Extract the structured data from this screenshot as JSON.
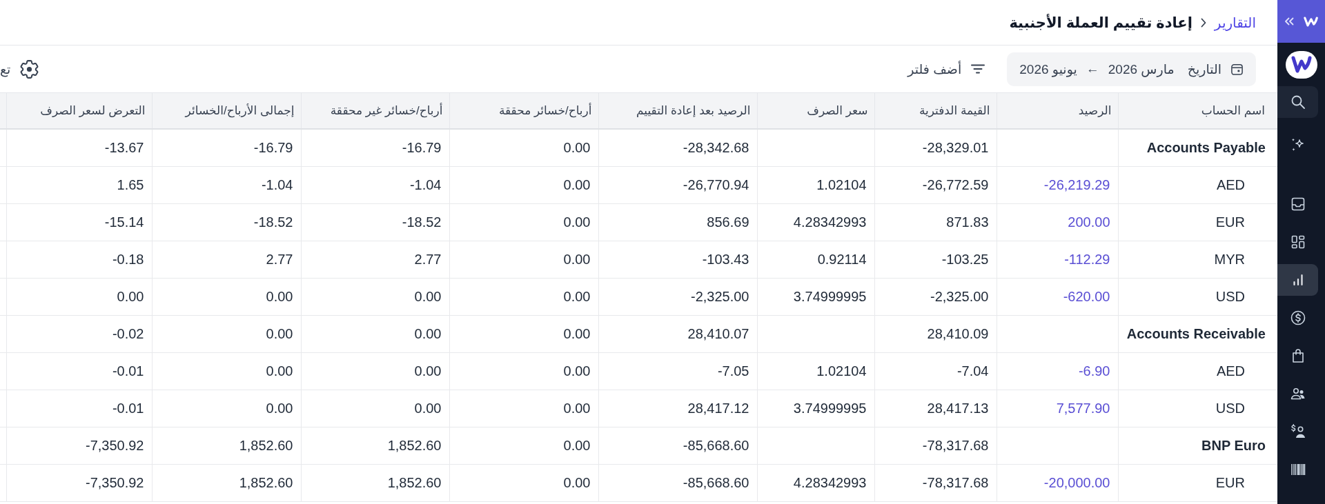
{
  "sidebar": {
    "items": [
      {
        "selected": false
      },
      {
        "selected": false
      },
      {
        "selected": false
      },
      {
        "selected": true
      },
      {
        "selected": false
      },
      {
        "selected": false
      },
      {
        "selected": false
      },
      {
        "selected": false
      },
      {
        "selected": false
      }
    ]
  },
  "header": {
    "breadcrumb": {
      "parent": "التقارير",
      "title": "إعادة تقييم العملة الأجنبية"
    }
  },
  "toolbar": {
    "date_filter": {
      "label": "التاريخ",
      "from": "مارس 2026",
      "arrow": "←",
      "to": "يونيو 2026"
    },
    "add_filter": {
      "label": "أضف فلتر"
    },
    "settings": {
      "label": "تع"
    }
  },
  "table": {
    "columns": [
      "اسم الحساب",
      "الرصيد",
      "القيمة الدفترية",
      "سعر الصرف",
      "الرصيد بعد إعادة التقييم",
      "أرباح/خسائر محققة",
      "أرباح/خسائر غير محققة",
      "إجمالى الأرباح/الخسائر",
      "التعرض لسعر الصرف"
    ],
    "rows": [
      {
        "name": "Accounts Payable",
        "book_value": "-28,329.01",
        "revalued_balance": "-28,342.68",
        "realized": "0.00",
        "unrealized": "-16.79",
        "total": "-16.79",
        "exposure": "-13.67",
        "children": [
          {
            "name": "AED",
            "balance": "-26,219.29",
            "book_value": "-26,772.59",
            "exchange_rate": "1.02104",
            "revalued_balance": "-26,770.94",
            "realized": "0.00",
            "unrealized": "-1.04",
            "total": "-1.04",
            "exposure": "1.65"
          },
          {
            "name": "EUR",
            "balance": "200.00",
            "book_value": "871.83",
            "exchange_rate": "4.28342993",
            "revalued_balance": "856.69",
            "realized": "0.00",
            "unrealized": "-18.52",
            "total": "-18.52",
            "exposure": "-15.14"
          },
          {
            "name": "MYR",
            "balance": "-112.29",
            "book_value": "-103.25",
            "exchange_rate": "0.92114",
            "revalued_balance": "-103.43",
            "realized": "0.00",
            "unrealized": "2.77",
            "total": "2.77",
            "exposure": "-0.18"
          },
          {
            "name": "USD",
            "balance": "-620.00",
            "book_value": "-2,325.00",
            "exchange_rate": "3.74999995",
            "revalued_balance": "-2,325.00",
            "realized": "0.00",
            "unrealized": "0.00",
            "total": "0.00",
            "exposure": "0.00"
          }
        ]
      },
      {
        "name": "Accounts Receivable",
        "book_value": "28,410.09",
        "revalued_balance": "28,410.07",
        "realized": "0.00",
        "unrealized": "0.00",
        "total": "0.00",
        "exposure": "-0.02",
        "children": [
          {
            "name": "AED",
            "balance": "-6.90",
            "book_value": "-7.04",
            "exchange_rate": "1.02104",
            "revalued_balance": "-7.05",
            "realized": "0.00",
            "unrealized": "0.00",
            "total": "0.00",
            "exposure": "-0.01"
          },
          {
            "name": "USD",
            "balance": "7,577.90",
            "book_value": "28,417.13",
            "exchange_rate": "3.74999995",
            "revalued_balance": "28,417.12",
            "realized": "0.00",
            "unrealized": "0.00",
            "total": "0.00",
            "exposure": "-0.01"
          }
        ]
      },
      {
        "name": "BNP Euro",
        "book_value": "-78,317.68",
        "revalued_balance": "-85,668.60",
        "realized": "0.00",
        "unrealized": "1,852.60",
        "total": "1,852.60",
        "exposure": "-7,350.92",
        "children": [
          {
            "name": "EUR",
            "balance": "-20,000.00",
            "book_value": "-78,317.68",
            "exchange_rate": "4.28342993",
            "revalued_balance": "-85,668.60",
            "realized": "0.00",
            "unrealized": "1,852.60",
            "total": "1,852.60",
            "exposure": "-7,350.92"
          }
        ]
      }
    ]
  }
}
